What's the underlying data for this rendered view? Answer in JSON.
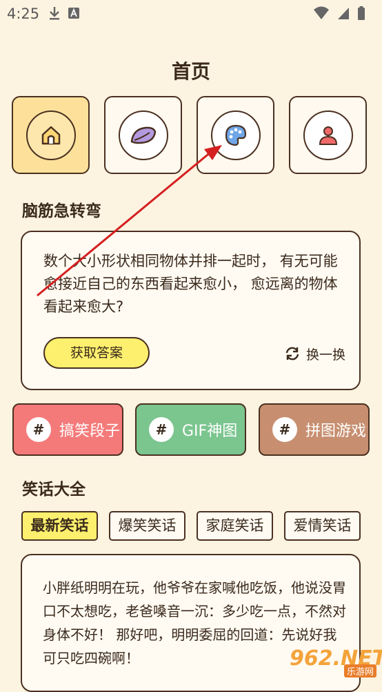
{
  "status": {
    "time": "4:25"
  },
  "page_title": "首页",
  "nav": [
    {
      "name": "home",
      "icon": "home-icon"
    },
    {
      "name": "leaf",
      "icon": "leaf-icon"
    },
    {
      "name": "palette",
      "icon": "palette-icon"
    },
    {
      "name": "profile",
      "icon": "user-icon"
    }
  ],
  "riddle": {
    "section_title": "脑筋急转弯",
    "question": "数个大小形状相同物体并排一起时， 有无可能愈接近自己的东西看起来愈小， 愈远离的物体看起来愈大?",
    "answer_label": "获取答案",
    "swap_label": "换一换"
  },
  "categories": [
    {
      "hash": "#",
      "label": "搞笑段子",
      "color": "#f47a7a"
    },
    {
      "hash": "#",
      "label": "GIF神图",
      "color": "#7bc58f"
    },
    {
      "hash": "#",
      "label": "拼图游戏",
      "color": "#c78f70"
    }
  ],
  "jokes": {
    "section_title": "笑话大全",
    "tabs": [
      "最新笑话",
      "爆笑笑话",
      "家庭笑话",
      "爱情笑话"
    ],
    "active_tab": "最新笑话",
    "text": "小胖纸明明在玩，他爷爷在家喊他吃饭，他说没胃口不太想吃，老爸嗓音一沉：多少吃一点，不然对身体不好！ 那好吧，明明委屈的回道：先说好我可只吃四碗啊！"
  },
  "watermark": {
    "main": "962.NET",
    "sub": "乐游网"
  },
  "colors": {
    "background": "#fdf3e1",
    "accent_yellow": "#fdf06e",
    "border": "#4a3020",
    "arrow": "#d42020"
  }
}
